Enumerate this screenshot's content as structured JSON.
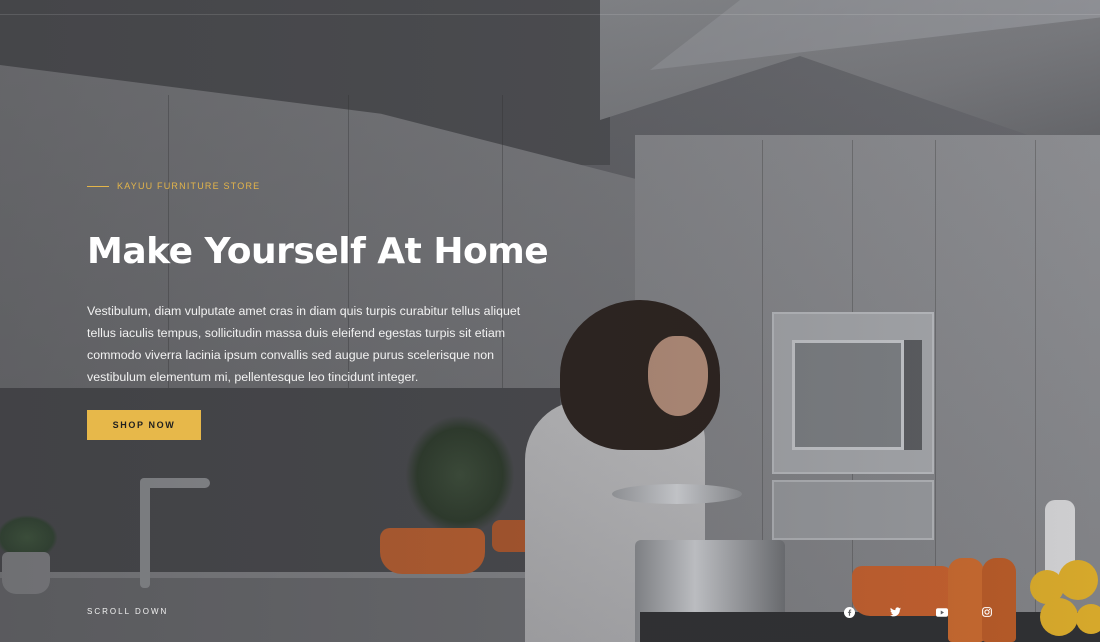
{
  "hero": {
    "eyebrow": "KAYUU FURNITURE STORE",
    "title": "Make Yourself At Home",
    "description": "Vestibulum, diam vulputate amet cras in diam quis turpis curabitur tellus aliquet tellus iaculis tempus, sollicitudin massa duis eleifend egestas turpis sit etiam commodo viverra lacinia ipsum convallis sed augue purus scelerisque non vestibulum elementum mi, pellentesque leo tincidunt integer.",
    "cta_label": "SHOP NOW",
    "scroll_label": "SCROLL DOWN"
  },
  "socials": [
    {
      "icon": "facebook-icon"
    },
    {
      "icon": "twitter-icon"
    },
    {
      "icon": "youtube-icon"
    },
    {
      "icon": "instagram-icon"
    }
  ],
  "colors": {
    "accent": "#e7b84a",
    "text": "#ffffff",
    "overlay": "#5e5f63"
  }
}
